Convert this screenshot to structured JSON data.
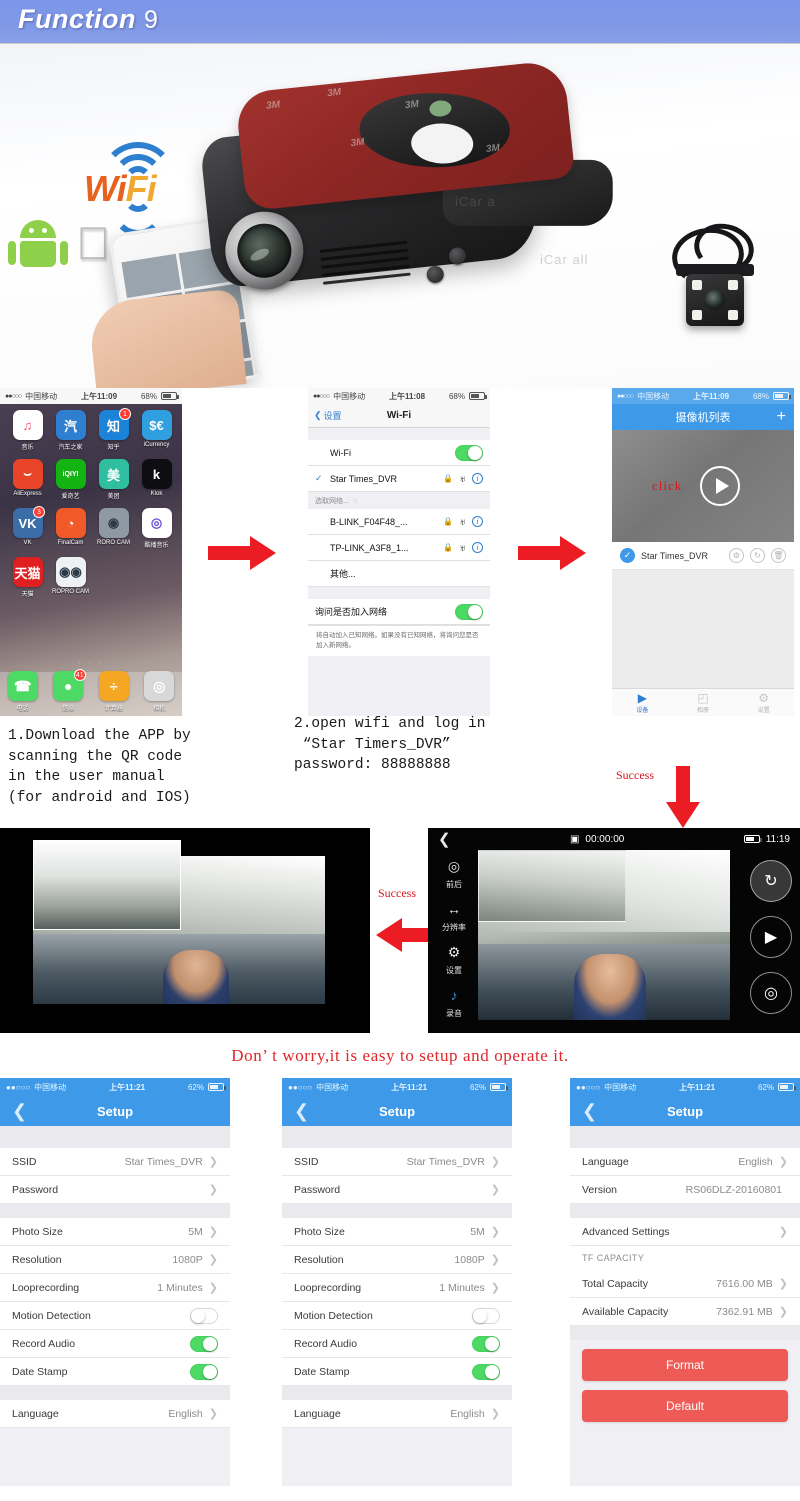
{
  "header": {
    "title": "Function",
    "number": "9"
  },
  "hero": {
    "wifi_logo": {
      "wi": "Wi",
      "fi": "Fi"
    },
    "watermark_1": "iCar a",
    "watermark_2": "iCar all",
    "adhesive_label": "3M"
  },
  "steps": {
    "home_screen": {
      "status": {
        "signal_dots": "●●○○○",
        "carrier": "中国移动",
        "time": "上午11:09",
        "battery": "68%"
      },
      "apps": [
        {
          "label": "音乐",
          "glyph": "♫",
          "bg": "#ffffff",
          "fg": "#f45b6e",
          "badge": ""
        },
        {
          "label": "汽车之家",
          "glyph": "汽",
          "bg": "#2f7fd0",
          "fg": "#ffffff",
          "badge": ""
        },
        {
          "label": "知乎",
          "glyph": "知",
          "bg": "#1b84d8",
          "fg": "#ffffff",
          "badge": "1"
        },
        {
          "label": "iCurrency",
          "glyph": "$€",
          "bg": "#2f9fe0",
          "fg": "#ffffff",
          "badge": ""
        },
        {
          "label": "AliExpress",
          "glyph": "⌣",
          "bg": "#e8442a",
          "fg": "#ffffff",
          "badge": ""
        },
        {
          "label": "爱奇艺",
          "glyph": "iQIYI",
          "bg": "#12b312",
          "fg": "#ffffff",
          "badge": ""
        },
        {
          "label": "美团",
          "glyph": "美",
          "bg": "#2fbfa0",
          "fg": "#ffffff",
          "badge": ""
        },
        {
          "label": "Klok",
          "glyph": "k",
          "bg": "#0d0d12",
          "fg": "#ffffff",
          "badge": ""
        },
        {
          "label": "VK",
          "glyph": "VK",
          "bg": "#3b6ea8",
          "fg": "#ffffff",
          "badge": "3"
        },
        {
          "label": "FinalCam",
          "glyph": "◔",
          "bg": "#f05a28",
          "fg": "#ffffff",
          "badge": ""
        },
        {
          "label": "RORO CAM",
          "glyph": "◉",
          "bg": "#8e99a4",
          "fg": "#2b3a46",
          "badge": ""
        },
        {
          "label": "酷播音乐",
          "glyph": "◎",
          "bg": "#ffffff",
          "fg": "#6b4fd8",
          "badge": ""
        },
        {
          "label": "天猫",
          "glyph": "天猫",
          "bg": "#e02020",
          "fg": "#ffffff",
          "badge": ""
        },
        {
          "label": "ROPRO CAM",
          "glyph": "◉◉",
          "bg": "#eef1f4",
          "fg": "#2b3a46",
          "badge": ""
        }
      ],
      "dock": [
        {
          "label": "电话",
          "glyph": "☎",
          "bg": "#4cd964",
          "badge": ""
        },
        {
          "label": "信息",
          "glyph": "●",
          "bg": "#4cd964",
          "badge": "41"
        },
        {
          "label": "计算器",
          "glyph": "÷",
          "bg": "#f5a623",
          "badge": ""
        },
        {
          "label": "相机",
          "glyph": "◎",
          "bg": "#d8d8d8",
          "badge": ""
        }
      ],
      "page_dots": "· · ·"
    },
    "wifi_screen": {
      "status": {
        "signal_dots": "●●○○○",
        "carrier": "中国移动",
        "time": "上午11:08",
        "battery": "68%"
      },
      "back_label": "设置",
      "nav_title": "Wi-Fi",
      "wifi_toggle_label": "Wi-Fi",
      "wifi_toggle_on": true,
      "connected_network": "Star Times_DVR",
      "choose_network_label": "选取网络...",
      "networks": [
        "B-LINK_F04F48_...",
        "TP-LINK_A3F8_1...",
        "其他..."
      ],
      "ask_join_label": "询问是否加入网络",
      "ask_join_on": true,
      "footer_note": "将自动加入已知网络。如果没有已知网络，将询问您是否加入新网络。"
    },
    "camera_list_screen": {
      "status": {
        "signal_dots": "●●○○○",
        "carrier": "中国移动",
        "time": "上午11:09",
        "battery": "68%"
      },
      "nav_title": "摄像机列表",
      "add_label": "+",
      "click_label": "click",
      "device_name": "Star Times_DVR",
      "tabs": [
        {
          "label": "设备",
          "glyph": "▶",
          "active": true
        },
        {
          "label": "相册",
          "glyph": "◰",
          "active": false
        },
        {
          "label": "设置",
          "glyph": "⚙",
          "active": false
        }
      ]
    },
    "caption_1": "1.Download the APP by\nscanning the QR code\nin the user manual\n(for android and IOS)",
    "caption_2": "2.open wifi and log in\n “Star Timers_DVR”\npassword: 88888888",
    "success_label_1": "Success",
    "success_label_2": "Success"
  },
  "video_row": {
    "camera_ui": {
      "timer": "00:00:00",
      "clock": "11:19",
      "sidebar": [
        {
          "label": "前后",
          "glyph": "◎"
        },
        {
          "label": "分辨率",
          "glyph": "↔"
        },
        {
          "label": "设置",
          "glyph": "⚙"
        },
        {
          "label": "录音",
          "glyph": "♪"
        }
      ],
      "buttons": [
        {
          "name": "switch-camera",
          "glyph": "↻"
        },
        {
          "name": "record-video",
          "glyph": "▶"
        },
        {
          "name": "take-photo",
          "glyph": "◎"
        }
      ]
    }
  },
  "tagline": "Don’ t worry,it is easy to setup and operate it.",
  "setup_screens": {
    "status": {
      "signal_dots": "●●○○○",
      "carrier": "中国移动",
      "time": "上午11:21",
      "battery": "62%"
    },
    "title": "Setup",
    "screen_a": {
      "rows_group1": [
        {
          "label": "SSID",
          "value": "Star Times_DVR",
          "type": "chevron"
        },
        {
          "label": "Password",
          "value": "",
          "type": "chevron"
        }
      ],
      "rows_group2": [
        {
          "label": "Photo Size",
          "value": "5M",
          "type": "chevron"
        },
        {
          "label": "Resolution",
          "value": "1080P",
          "type": "chevron"
        },
        {
          "label": "Looprecording",
          "value": "1 Minutes",
          "type": "chevron"
        },
        {
          "label": "Motion Detection",
          "value": "",
          "type": "toggle-off"
        },
        {
          "label": "Record Audio",
          "value": "",
          "type": "toggle-on"
        },
        {
          "label": "Date Stamp",
          "value": "",
          "type": "toggle-on"
        }
      ],
      "rows_group3": [
        {
          "label": "Language",
          "value": "English",
          "type": "chevron"
        }
      ]
    },
    "screen_c": {
      "rows_group1": [
        {
          "label": "Language",
          "value": "English",
          "type": "chevron"
        },
        {
          "label": "Version",
          "value": "RS06DLZ-20160801",
          "type": "plain"
        }
      ],
      "rows_group2": [
        {
          "label": "Advanced Settings",
          "value": "",
          "type": "chevron"
        }
      ],
      "section_header": "TF CAPACITY",
      "rows_group3": [
        {
          "label": "Total Capacity",
          "value": "7616.00 MB",
          "type": "chevron"
        },
        {
          "label": "Available Capacity",
          "value": "7362.91 MB",
          "type": "chevron"
        }
      ],
      "buttons": [
        {
          "label": "Format"
        },
        {
          "label": "Default"
        }
      ]
    }
  },
  "colors": {
    "header_blue": "#7e97e6",
    "ios_blue": "#3e9ae8",
    "arrow_red": "#ec1c24",
    "text_red": "#d8171c",
    "toggle_green": "#4cd964",
    "button_red": "#ee5a56"
  }
}
